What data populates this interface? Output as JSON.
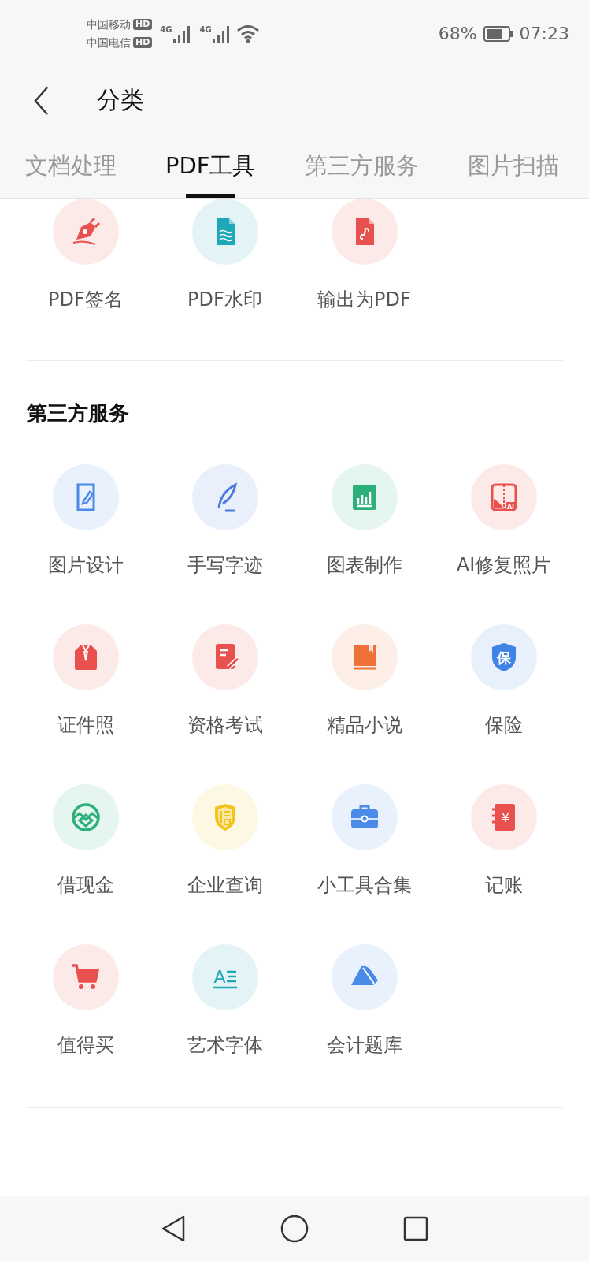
{
  "status_bar": {
    "carriers": [
      {
        "name": "中国移动",
        "badge": "HD"
      },
      {
        "name": "中国电信",
        "badge": "HD"
      }
    ],
    "networks": [
      "4G",
      "4G"
    ],
    "battery": "68%",
    "time": "07:23"
  },
  "header": {
    "title": "分类"
  },
  "tabs": [
    {
      "label": "文档处理",
      "selected": false
    },
    {
      "label": "PDF工具",
      "selected": true
    },
    {
      "label": "第三方服务",
      "selected": false
    },
    {
      "label": "图片扫描",
      "selected": false
    }
  ],
  "sections": [
    {
      "items": [
        {
          "label": "PDF签名",
          "color": "#e8514e"
        },
        {
          "label": "PDF水印",
          "color": "#1fa8b8"
        },
        {
          "label": "输出为PDF",
          "color": "#e8514e"
        }
      ]
    },
    {
      "title": "第三方服务",
      "items": [
        {
          "label": "图片设计",
          "color": "#4a8ae8"
        },
        {
          "label": "手写字迹",
          "color": "#4a7be0"
        },
        {
          "label": "图表制作",
          "color": "#2bb07a"
        },
        {
          "label": "AI修复照片",
          "color": "#e8514e",
          "icon_text": "AI"
        },
        {
          "label": "证件照",
          "color": "#e8514e"
        },
        {
          "label": "资格考试",
          "color": "#e8514e"
        },
        {
          "label": "精品小说",
          "color": "#f0703a"
        },
        {
          "label": "保险",
          "color": "#3f84e5",
          "icon_text": "保"
        },
        {
          "label": "借现金",
          "color": "#2bb07a"
        },
        {
          "label": "企业查询",
          "color": "#f2c31b"
        },
        {
          "label": "小工具合集",
          "color": "#4a8ae8"
        },
        {
          "label": "记账",
          "color": "#e8514e",
          "icon_text": "¥"
        },
        {
          "label": "值得买",
          "color": "#e8514e"
        },
        {
          "label": "艺术字体",
          "color": "#1fa8b8",
          "icon_text": "A"
        },
        {
          "label": "会计题库",
          "color": "#4a8ae8"
        }
      ]
    }
  ]
}
